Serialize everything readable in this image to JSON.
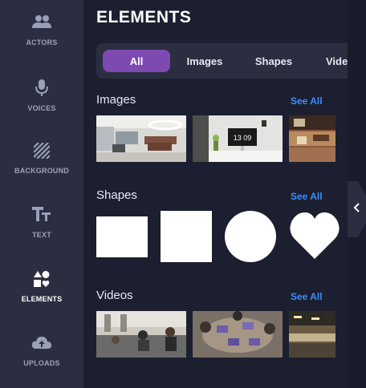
{
  "rail": {
    "items": [
      {
        "label": "ACTORS",
        "icon": "actors-icon"
      },
      {
        "label": "VOICES",
        "icon": "microphone-icon"
      },
      {
        "label": "BACKGROUND",
        "icon": "background-icon"
      },
      {
        "label": "TEXT",
        "icon": "text-icon"
      },
      {
        "label": "ELEMENTS",
        "icon": "elements-icon",
        "active": true
      },
      {
        "label": "UPLOADS",
        "icon": "upload-cloud-icon"
      }
    ]
  },
  "panel": {
    "title": "ELEMENTS",
    "tabs": [
      "All",
      "Images",
      "Shapes",
      "Video"
    ],
    "active_tab": "All",
    "sections": {
      "images": {
        "title": "Images",
        "see_all": "See All"
      },
      "shapes": {
        "title": "Shapes",
        "see_all": "See All"
      },
      "videos": {
        "title": "Videos",
        "see_all": "See All"
      }
    },
    "clock_text": "13 09"
  },
  "colors": {
    "background": "#1c1f2f",
    "rail": "#2b2e41",
    "accent": "#7c4ab0",
    "link": "#3a8dff"
  }
}
